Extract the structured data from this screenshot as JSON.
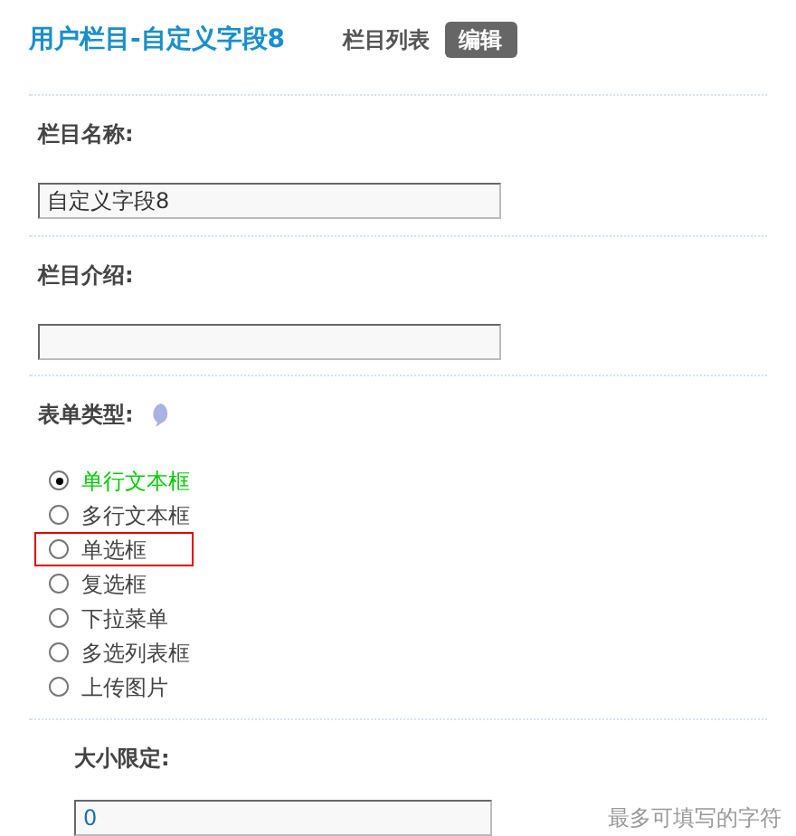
{
  "header": {
    "title": "用户栏目-自定义字段8",
    "links": [
      {
        "label": "栏目列表",
        "selected": false
      },
      {
        "label": "编辑",
        "selected": true
      }
    ]
  },
  "name_field": {
    "label": "栏目名称:",
    "value": "自定义字段8"
  },
  "intro_field": {
    "label": "栏目介绍:"
  },
  "form_type": {
    "label": "表单类型:",
    "options": [
      {
        "label": "单行文本框",
        "selected": true,
        "focused": false
      },
      {
        "label": "多行文本框",
        "selected": false,
        "focused": false
      },
      {
        "label": "单选框",
        "selected": false,
        "focused": true
      },
      {
        "label": "复选框",
        "selected": false,
        "focused": false
      },
      {
        "label": "下拉菜单",
        "selected": false,
        "focused": false
      },
      {
        "label": "多选列表框",
        "selected": false,
        "focused": false
      },
      {
        "label": "上传图片",
        "selected": false,
        "focused": false
      }
    ]
  },
  "size_limit": {
    "label": "大小限定:",
    "value": "0",
    "hint": "最多可填写的字符"
  }
}
